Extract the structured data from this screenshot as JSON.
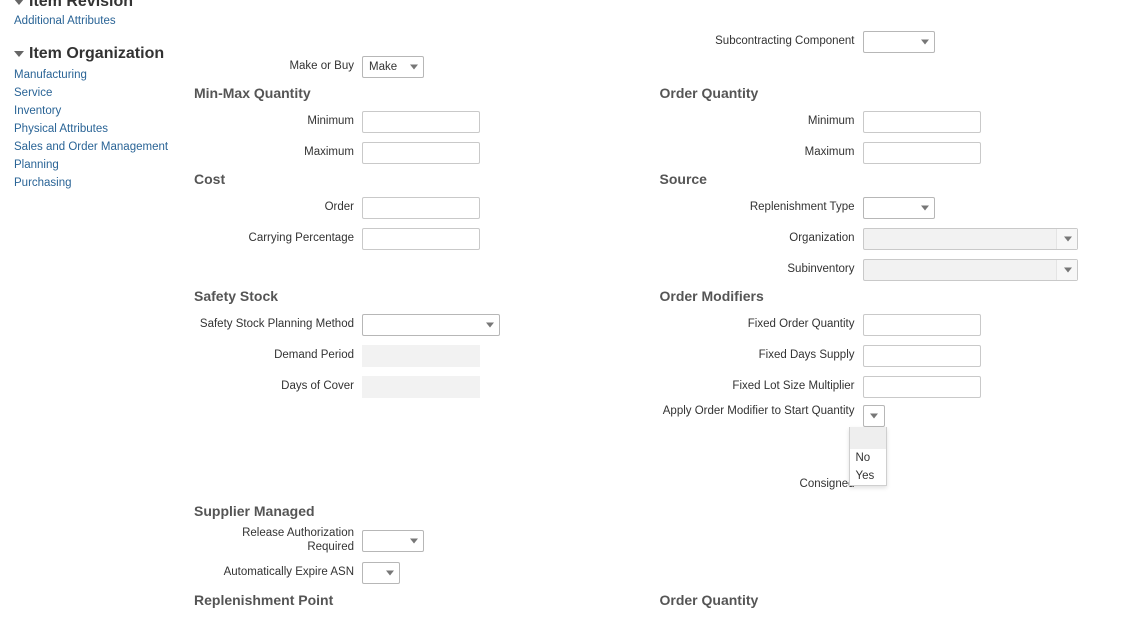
{
  "sidebar": {
    "revision_title": "Item Revision",
    "revision_link": "Additional Attributes",
    "org_title": "Item Organization",
    "links": [
      "Manufacturing",
      "Service",
      "Inventory",
      "Physical Attributes",
      "Sales and Order Management",
      "Planning",
      "Purchasing"
    ]
  },
  "top": {
    "make_or_buy_label": "Make or Buy",
    "make_or_buy_value": "Make",
    "subcontracting_label": "Subcontracting Component"
  },
  "minmax": {
    "title": "Min-Max Quantity",
    "minimum_label": "Minimum",
    "maximum_label": "Maximum"
  },
  "orderqty": {
    "title": "Order Quantity",
    "minimum_label": "Minimum",
    "maximum_label": "Maximum"
  },
  "orderqty2": {
    "title": "Order Quantity"
  },
  "cost": {
    "title": "Cost",
    "order_label": "Order",
    "carrying_label": "Carrying Percentage"
  },
  "source": {
    "title": "Source",
    "replenish_label": "Replenishment Type",
    "org_label": "Organization",
    "subinv_label": "Subinventory"
  },
  "safety": {
    "title": "Safety Stock",
    "method_label": "Safety Stock Planning Method",
    "demand_label": "Demand Period",
    "cover_label": "Days of Cover"
  },
  "modifiers": {
    "title": "Order Modifiers",
    "fixed_qty_label": "Fixed Order Quantity",
    "fixed_days_label": "Fixed Days Supply",
    "fixed_lot_label": "Fixed Lot Size Multiplier",
    "apply_label": "Apply Order Modifier to Start Quantity",
    "consigned_label": "Consigned",
    "dropdown_options": [
      "",
      "No",
      "Yes"
    ]
  },
  "supplier": {
    "title": "Supplier Managed",
    "release_label": "Release Authorization Required",
    "auto_label": "Automatically Expire ASN"
  },
  "replenish": {
    "title": "Replenishment Point"
  }
}
